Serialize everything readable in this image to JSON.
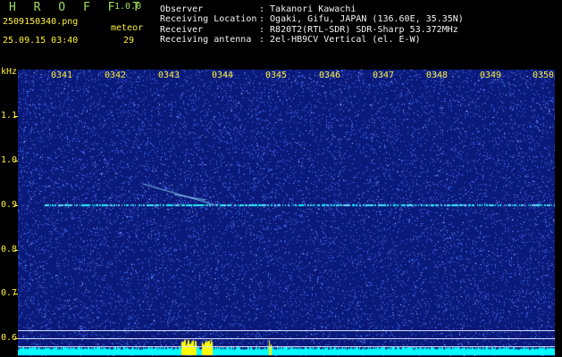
{
  "header": {
    "app_name": "H R O F F T",
    "version": "1.0.0",
    "filename": "2509150340.png",
    "meteor_label": "meteor",
    "datetime": "25.09.15 03:40",
    "meteor_count": "29",
    "info_rows": [
      {
        "label": "Observer",
        "value": ": Takanori Kawachi"
      },
      {
        "label": "Receiving Location",
        "value": ": Ogaki, Gifu, JAPAN (136.60E, 35.35N)"
      },
      {
        "label": "Receiver",
        "value": ": R820T2(RTL-SDR) SDR-Sharp 53.372MHz"
      },
      {
        "label": "Receiving antenna",
        "value": ": 2el-HB9CV Vertical (el. E-W)"
      }
    ]
  },
  "spectrogram": {
    "y_unit": "kHz",
    "y_ticks": [
      "1.1",
      "1.0",
      "0.9",
      "0.8",
      "0.7",
      "0.6"
    ],
    "y_values": [
      1.1,
      1.0,
      0.9,
      0.8,
      0.7,
      0.6
    ],
    "x_ticks": [
      "0341",
      "0342",
      "0343",
      "0344",
      "0345",
      "0346",
      "0347",
      "0348",
      "0349",
      "0350"
    ],
    "carrier_khz": 0.9,
    "colors": {
      "background": "#0a1a7a",
      "noise": "#4a72ff",
      "signal": "#00ffff",
      "meteor": "#ffff00",
      "labels": "#ffef3a"
    }
  }
}
